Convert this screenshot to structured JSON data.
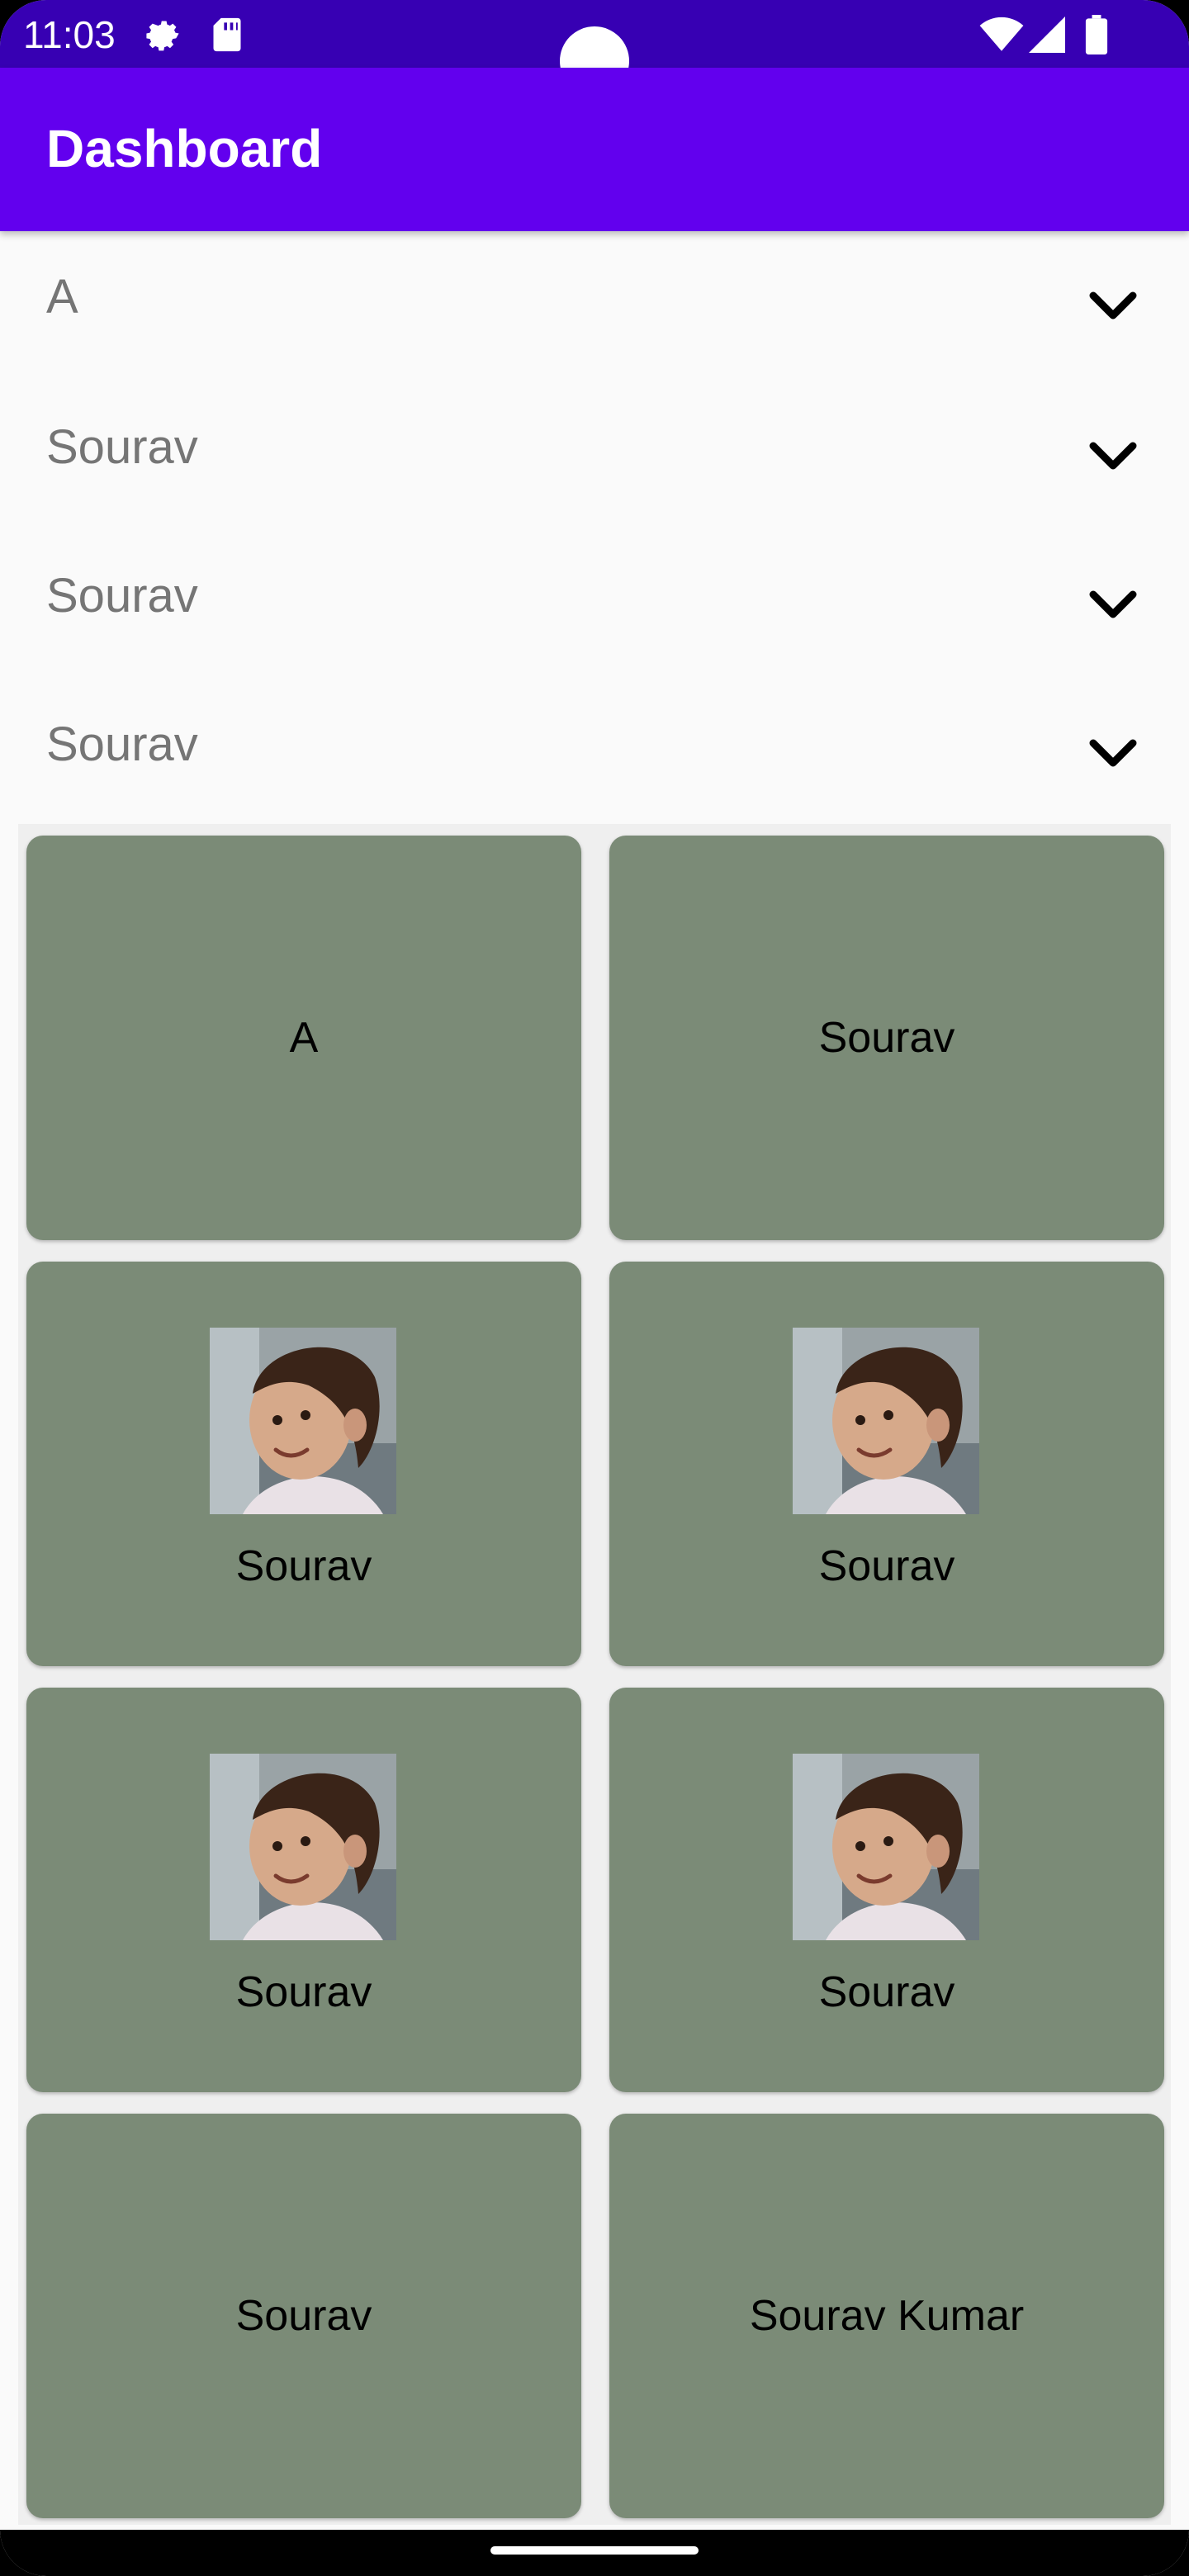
{
  "status_bar": {
    "time": "11:03",
    "icons": [
      "settings-gear-icon",
      "sd-card-icon",
      "wifi-icon",
      "cell-signal-icon",
      "battery-icon"
    ],
    "background": "#3700b3"
  },
  "app_bar": {
    "title": "Dashboard",
    "background": "#6200ee"
  },
  "dropdowns": [
    {
      "value": "A",
      "icon": "chevron-down-icon"
    },
    {
      "value": "Sourav",
      "icon": "chevron-down-icon"
    },
    {
      "value": "Sourav",
      "icon": "chevron-down-icon"
    },
    {
      "value": "Sourav",
      "icon": "chevron-down-icon"
    }
  ],
  "cards": [
    {
      "label": "A",
      "has_photo": false
    },
    {
      "label": "Sourav",
      "has_photo": false
    },
    {
      "label": "Sourav",
      "has_photo": true
    },
    {
      "label": "Sourav",
      "has_photo": true
    },
    {
      "label": "Sourav",
      "has_photo": true
    },
    {
      "label": "Sourav",
      "has_photo": true
    },
    {
      "label": "Sourav",
      "has_photo": false
    },
    {
      "label": "Sourav Kumar",
      "has_photo": false
    }
  ],
  "colors": {
    "card_background": "#7b8b77",
    "page_background": "#fafafa",
    "dropdown_text": "#757575"
  }
}
